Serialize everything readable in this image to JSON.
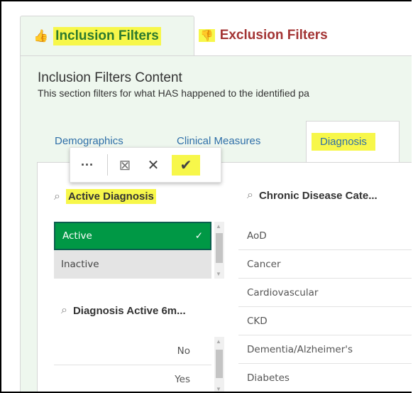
{
  "outer_tabs": {
    "inclusion_icon": "👍",
    "inclusion_label": "Inclusion Filters",
    "exclusion_icon": "👎",
    "exclusion_label": "Exclusion Filters"
  },
  "content": {
    "title": "Inclusion Filters Content",
    "description": "This section filters for what HAS happened to the identified pa"
  },
  "inner_tabs": [
    {
      "label": "Demographics"
    },
    {
      "label": "Clinical Measures"
    },
    {
      "label": "Diagnosis"
    }
  ],
  "toolbar": {
    "more": "···",
    "clear_selection": "⊠",
    "cancel": "✕",
    "confirm": "✔"
  },
  "active_diagnosis": {
    "search_icon": "⌕",
    "title": "Active Diagnosis",
    "items": [
      {
        "label": "Active",
        "state": "selected",
        "check": "✓"
      },
      {
        "label": "Inactive",
        "state": "alternative"
      }
    ]
  },
  "diagnosis_active_6m": {
    "search_icon": "⌕",
    "title": "Diagnosis Active 6m...",
    "items": [
      {
        "label": "No"
      },
      {
        "label": "Yes"
      }
    ]
  },
  "chronic_disease": {
    "search_icon": "⌕",
    "title": "Chronic Disease Cate...",
    "items": [
      {
        "label": "AoD"
      },
      {
        "label": "Cancer"
      },
      {
        "label": "Cardiovascular"
      },
      {
        "label": "CKD"
      },
      {
        "label": "Dementia/Alzheimer's"
      },
      {
        "label": "Diabetes"
      }
    ]
  },
  "colors": {
    "highlight": "#f7f74a",
    "selected_green": "#009845",
    "inclusion_green": "#2d7a2d",
    "exclusion_red": "#a33434",
    "tab_blue": "#2f6fa8"
  }
}
